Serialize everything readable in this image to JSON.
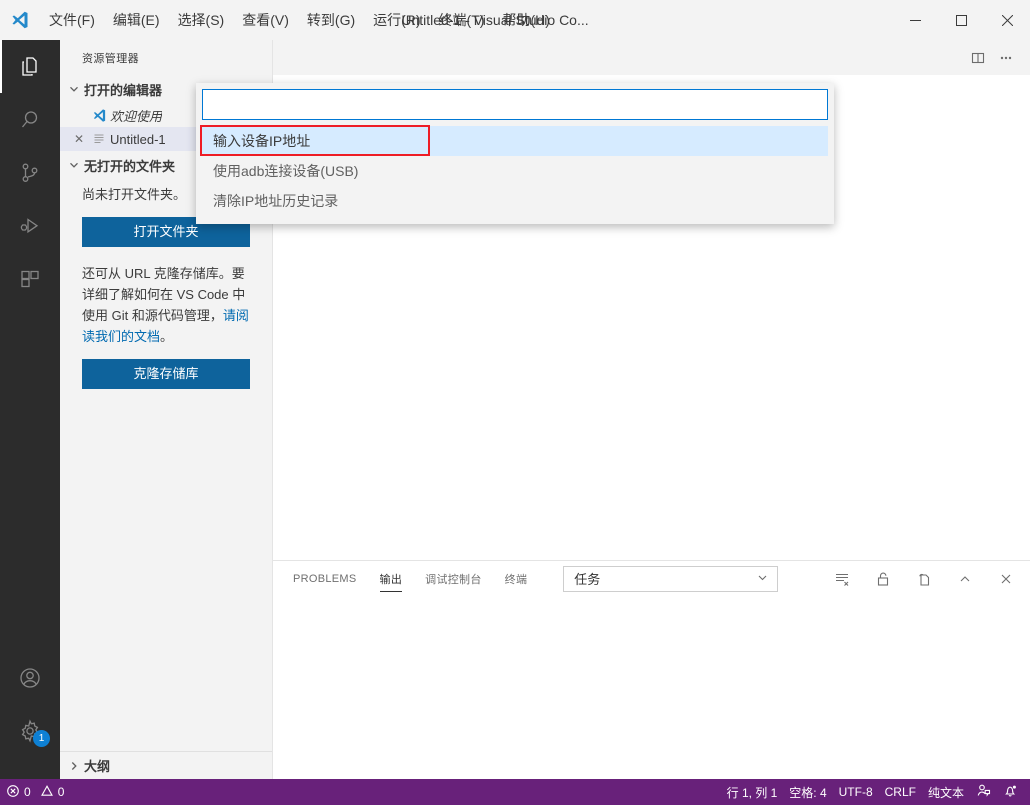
{
  "titlebar": {
    "logo_icon": "vscode-logo-icon",
    "window_title": "Untitled-1 - Visual Studio Co...",
    "menus": [
      {
        "label": "文件(F)",
        "name": "menu-file"
      },
      {
        "label": "编辑(E)",
        "name": "menu-edit"
      },
      {
        "label": "选择(S)",
        "name": "menu-selection"
      },
      {
        "label": "查看(V)",
        "name": "menu-view"
      },
      {
        "label": "转到(G)",
        "name": "menu-go"
      },
      {
        "label": "运行(R)",
        "name": "menu-run"
      },
      {
        "label": "终端(T)",
        "name": "menu-terminal"
      },
      {
        "label": "帮助(H)",
        "name": "menu-help"
      }
    ],
    "controls": {
      "minimize": "—",
      "maximize": "□",
      "close": "✕"
    }
  },
  "activitybar": {
    "items": [
      {
        "name": "activitybar-explorer",
        "icon": "files-icon",
        "active": true
      },
      {
        "name": "activitybar-search",
        "icon": "search-icon",
        "active": false
      },
      {
        "name": "activitybar-source-control",
        "icon": "source-control-icon",
        "active": false
      },
      {
        "name": "activitybar-run-debug",
        "icon": "run-and-debug-icon",
        "active": false
      },
      {
        "name": "activitybar-extensions",
        "icon": "extensions-icon",
        "active": false
      }
    ],
    "bottom": [
      {
        "name": "activitybar-accounts",
        "icon": "account-icon",
        "badge": ""
      },
      {
        "name": "activitybar-settings",
        "icon": "gear-icon",
        "badge": "1"
      }
    ]
  },
  "sidebar": {
    "title": "资源管理器",
    "open_editors": {
      "header": "打开的编辑器",
      "items": [
        {
          "label": "欢迎使用",
          "icon": "vscode-logo-icon",
          "italic": true,
          "selected": false,
          "close": ""
        },
        {
          "label": "Untitled-1",
          "icon": "file-icon",
          "italic": false,
          "selected": true,
          "close": "✕"
        }
      ]
    },
    "no_folder": {
      "header": "无打开的文件夹",
      "message": "尚未打开文件夹。",
      "open_folder_button": "打开文件夹",
      "clone_text_part1": "还可从 URL 克隆存储库。要详细了解如何在 VS Code 中使用 Git 和源代码管理，",
      "clone_link": "请阅读我们的文档",
      "clone_text_part2": "。",
      "clone_button": "克隆存储库"
    },
    "outline": {
      "header": "大纲"
    }
  },
  "editor": {
    "actions": [
      {
        "name": "split-editor-icon",
        "icon": "split-editor"
      },
      {
        "name": "more-actions-icon",
        "icon": "ellipsis"
      }
    ]
  },
  "panel": {
    "tabs": [
      {
        "label": "PROBLEMS",
        "name": "panel-tab-problems",
        "active": false
      },
      {
        "label": "输出",
        "name": "panel-tab-output",
        "active": true
      },
      {
        "label": "调试控制台",
        "name": "panel-tab-debug-console",
        "active": false
      },
      {
        "label": "终端",
        "name": "panel-tab-terminal",
        "active": false
      }
    ],
    "channel_select": {
      "value": "任务",
      "chevron": "chevron-down-icon"
    },
    "actions": [
      {
        "name": "clear-output-icon"
      },
      {
        "name": "lock-scrolling-icon"
      },
      {
        "name": "open-in-editor-icon"
      },
      {
        "name": "maximize-panel-icon"
      },
      {
        "name": "close-panel-icon"
      }
    ]
  },
  "quickpick": {
    "input_value": "",
    "input_placeholder": "",
    "items": [
      {
        "label": "输入设备IP地址",
        "name": "quickpick-item-enter-ip",
        "focused": true
      },
      {
        "label": "使用adb连接设备(USB)",
        "name": "quickpick-item-adb-usb",
        "focused": false
      },
      {
        "label": "清除IP地址历史记录",
        "name": "quickpick-item-clear-history",
        "focused": false
      }
    ]
  },
  "statusbar": {
    "errors": "0",
    "warnings": "0",
    "line_col": "行 1, 列 1",
    "spaces": "空格: 4",
    "encoding": "UTF-8",
    "eol": "CRLF",
    "language": "纯文本",
    "feedback_icon": "feedback-icon",
    "bell_icon": "bell-icon"
  },
  "colors": {
    "statusbar_bg": "#68217a",
    "accent_blue": "#0e639c",
    "focus_blue": "#0078d4",
    "annotation_red": "#ee1c25",
    "quickpick_focus_bg": "#d6ebff"
  }
}
